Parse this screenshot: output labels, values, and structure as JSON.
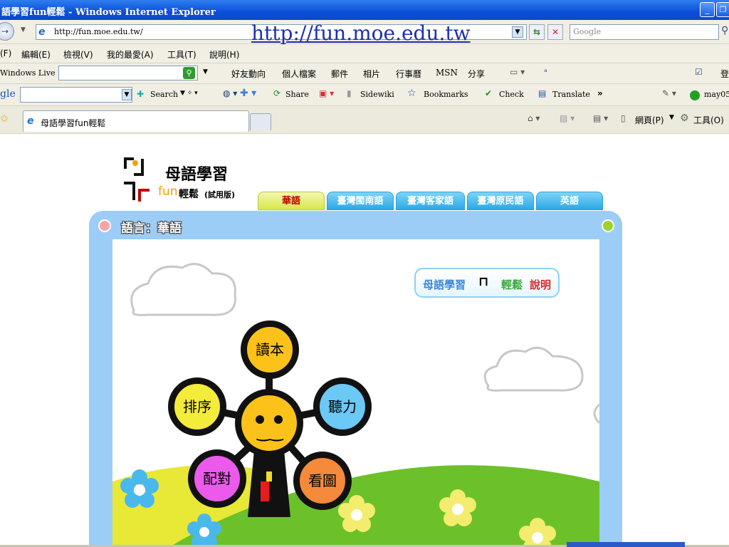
{
  "window": {
    "title": "語學習fun輕鬆 - Windows Internet Explorer"
  },
  "address_bar": {
    "url": "http://fun.moe.edu.tw/",
    "search_placeholder": "Google"
  },
  "overlay_url": "http://fun.moe.edu.tw",
  "menu": [
    "(F)",
    "編輯(E)",
    "檢視(V)",
    "我的最愛(A)",
    "工具(T)",
    "說明(H)"
  ],
  "live_toolbar": {
    "label": "Windows Live",
    "items": [
      "好友動向",
      "個人檔案",
      "郵件",
      "相片",
      "行事曆",
      "MSN",
      "分享"
    ],
    "right_label": "登"
  },
  "google_toolbar": {
    "label": "gle",
    "items": [
      "Search",
      "Share",
      "Sidewiki",
      "Bookmarks",
      "Check",
      "Translate",
      "»"
    ],
    "user": "may05"
  },
  "tab_bar": {
    "tab_label": "母語學習fun輕鬆",
    "page_label": "網頁(P)",
    "tools_label": "工具(O)"
  },
  "site": {
    "logo_title": "母語學習",
    "logo_fun": "fun",
    "logo_easy": "輕鬆",
    "logo_trial": "(試用版)",
    "tabs": [
      "華語",
      "臺灣閩南語",
      "臺灣客家語",
      "臺灣原民語",
      "英語"
    ],
    "active_tab": 0,
    "language_header": "語言：華語",
    "help_button": {
      "part1": "母語學習",
      "part2": "輕鬆",
      "part3": "說明"
    },
    "nodes": {
      "top": "讀本",
      "left": "排序",
      "right": "聽力",
      "bottom_left": "配對",
      "bottom_right": "看圖"
    }
  },
  "colors": {
    "titlebar": "#0a4fd8",
    "frame": "#9ccdf6",
    "active_tab": "#d6e84b",
    "grass": "#6cc12a"
  }
}
